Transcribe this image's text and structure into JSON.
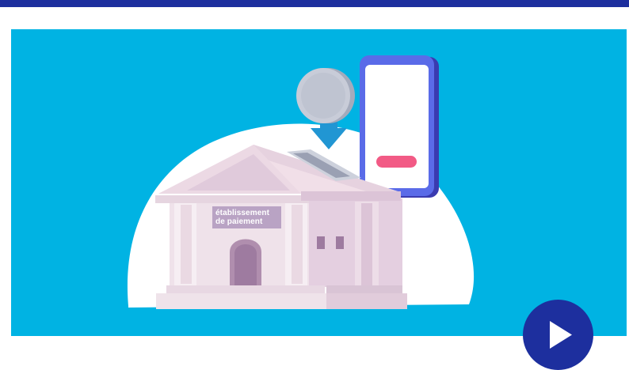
{
  "video": {
    "bank_label_line1": "établissement",
    "bank_label_line2": "de paiement"
  },
  "controls": {
    "play_icon": "play-icon"
  },
  "colors": {
    "top_bar": "#1d2f9e",
    "background": "#00b3e3",
    "play_button": "#1d2f9e",
    "phone_button": "#f25a85"
  }
}
